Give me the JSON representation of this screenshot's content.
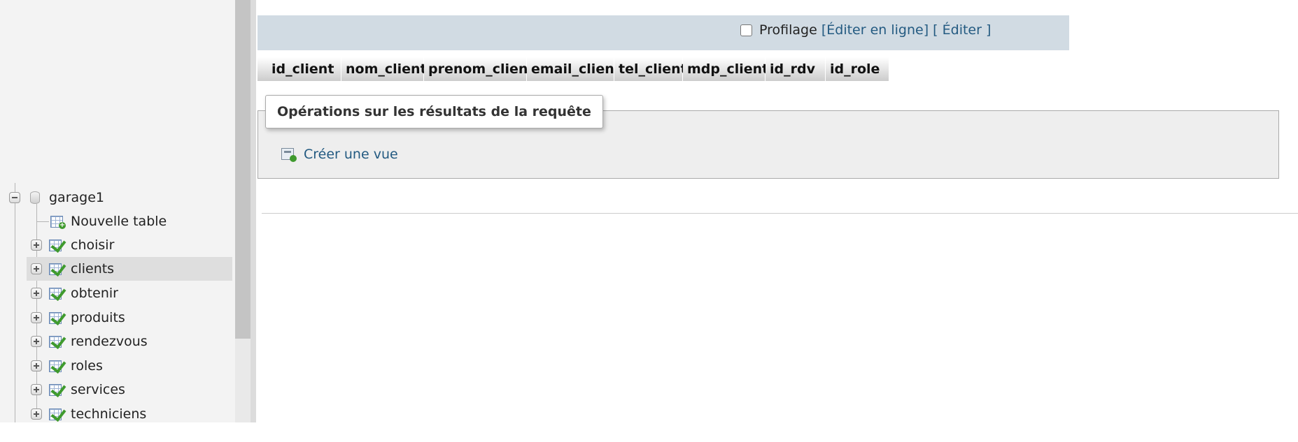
{
  "sidebar": {
    "database": {
      "name": "garage1"
    },
    "new_table_label": "Nouvelle table",
    "tables": [
      {
        "label": "choisir"
      },
      {
        "label": "clients"
      },
      {
        "label": "obtenir"
      },
      {
        "label": "produits"
      },
      {
        "label": "rendezvous"
      },
      {
        "label": "roles"
      },
      {
        "label": "services"
      },
      {
        "label": "techniciens"
      }
    ],
    "selected_table": "clients"
  },
  "toolbar": {
    "profiling_label": "Profilage",
    "profiling_checked": false,
    "edit_inline_link": "[Éditer en ligne]",
    "edit_link": "[ Éditer ]"
  },
  "results": {
    "columns": [
      "id_client",
      "nom_client",
      "prenom_client",
      "email_client",
      "tel_client",
      "mdp_client",
      "id_rdv",
      "id_role"
    ]
  },
  "operations": {
    "legend": "Opérations sur les résultats de la requête",
    "create_view_label": "Créer une vue"
  },
  "icons": {
    "expander_open": "minus-box-icon",
    "expander_closed": "plus-box-icon",
    "database": "database-icon",
    "table": "table-icon",
    "new_table": "new-table-icon",
    "create_view": "create-view-icon"
  },
  "colors": {
    "link": "#235a81",
    "top_bar": "#d1dbe3",
    "selected_row": "#dedede",
    "fieldset_bg": "#eeeeee"
  }
}
